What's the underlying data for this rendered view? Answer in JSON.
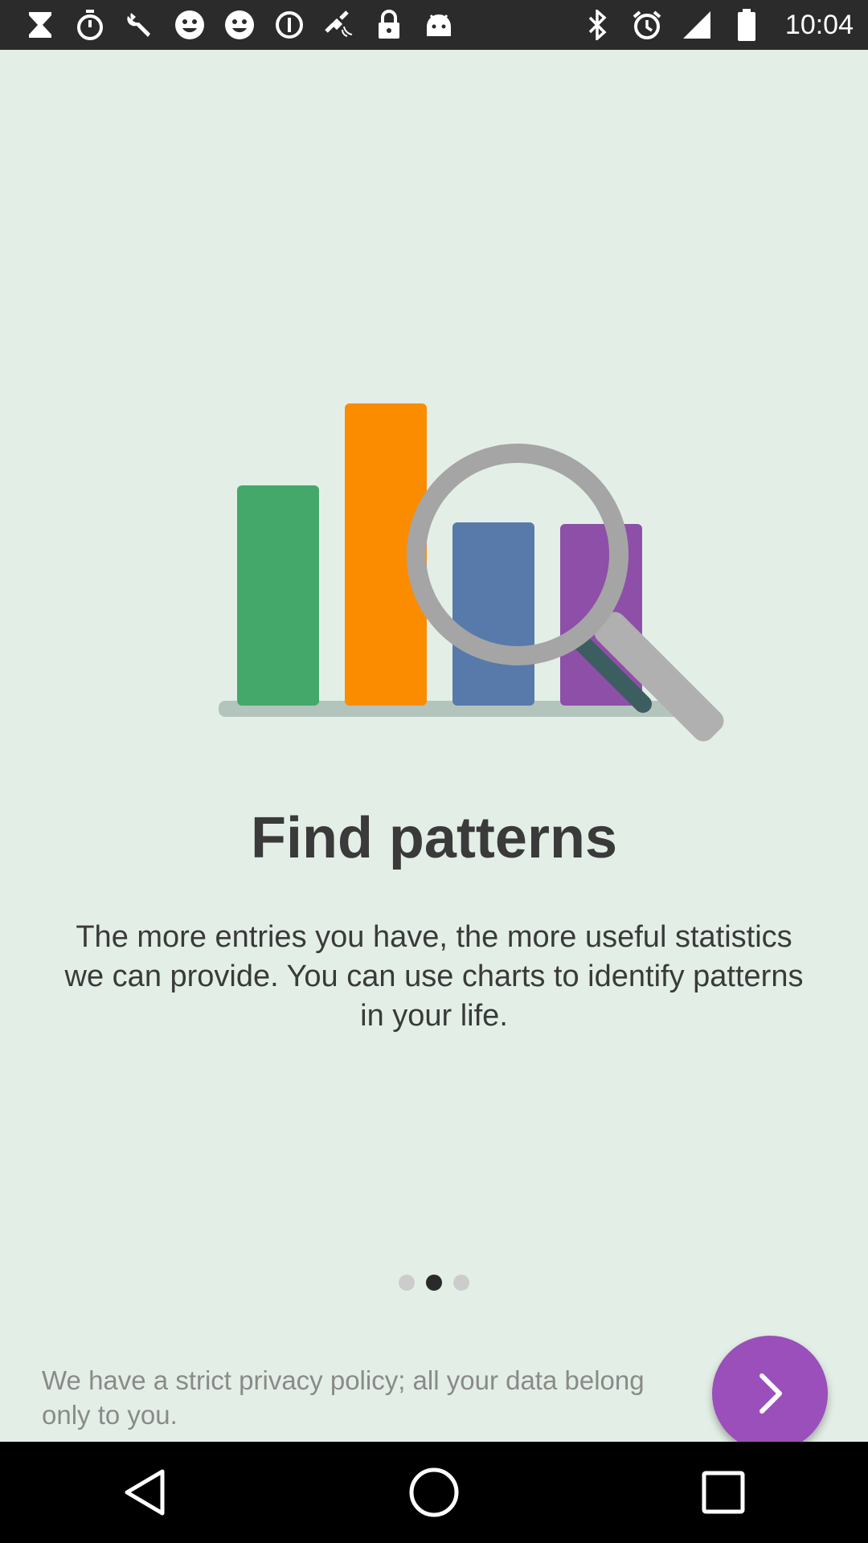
{
  "status_bar": {
    "time": "10:04",
    "left_icons": [
      "hourglass-icon",
      "stopwatch-icon",
      "wrench-icon",
      "smiley-icon",
      "smiley-icon",
      "info-icon",
      "fake-gps-satellite-icon",
      "lock-icon",
      "android-icon"
    ],
    "right_icons": [
      "bluetooth-icon",
      "alarm-icon",
      "signal-icon",
      "battery-icon"
    ]
  },
  "onboarding": {
    "title": "Find patterns",
    "description": "The more entries you have, the more useful statistics we can provide. You can use charts to identify patterns in your life.",
    "privacy_note": "We have a strict privacy policy; all your data belong only to you.",
    "page_indicator": {
      "total": 3,
      "current": 2
    },
    "next_button_icon": "chevron-right-icon",
    "accent_color": "#9b4fba",
    "illustration_colors": [
      "#44a86a",
      "#fb8c00",
      "#577aaa",
      "#8e4fa8"
    ]
  },
  "nav_bar": {
    "buttons": [
      "back-icon",
      "home-icon",
      "recents-icon"
    ]
  }
}
